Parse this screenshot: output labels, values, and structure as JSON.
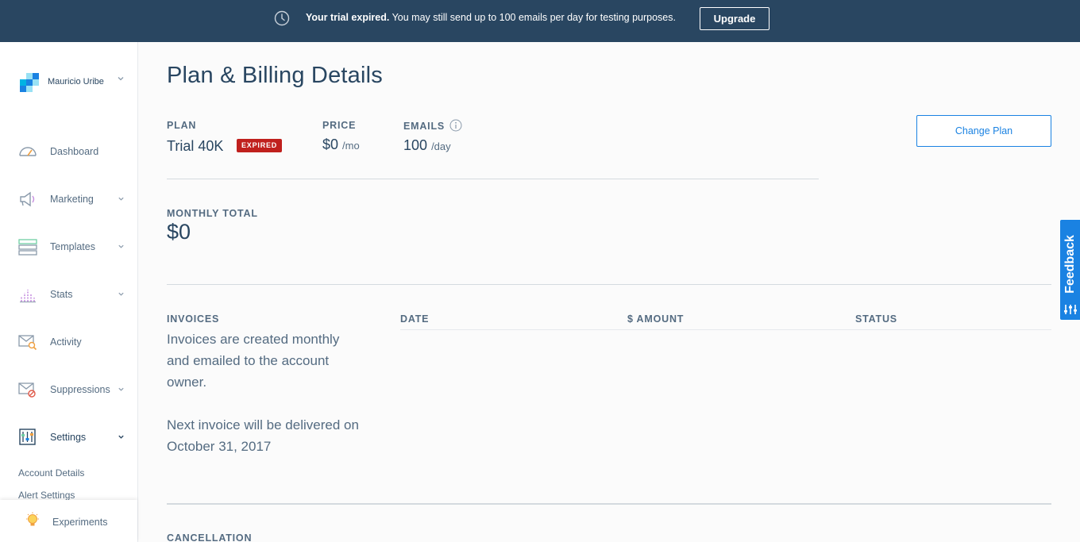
{
  "banner": {
    "icon": "clock-icon",
    "message_bold": "Your trial expired.",
    "message_rest": " You may still send up to 100 emails per day for testing purposes.",
    "upgrade_label": "Upgrade"
  },
  "sidebar": {
    "user_name": "Mauricio Uribe",
    "items": [
      {
        "label": "Dashboard",
        "icon": "speedometer-icon"
      },
      {
        "label": "Marketing",
        "icon": "megaphone-icon"
      },
      {
        "label": "Templates",
        "icon": "template-icon"
      },
      {
        "label": "Stats",
        "icon": "bar-chart-icon"
      },
      {
        "label": "Activity",
        "icon": "envelope-search-icon"
      },
      {
        "label": "Suppressions",
        "icon": "envelope-block-icon"
      },
      {
        "label": "Settings",
        "icon": "sliders-icon"
      }
    ],
    "settings_sub": [
      "Account Details",
      "Alert Settings"
    ],
    "experiments_label": "Experiments"
  },
  "main": {
    "title": "Plan & Billing Details",
    "plan": {
      "label": "PLAN",
      "value": "Trial 40K",
      "badge": "EXPIRED"
    },
    "price": {
      "label": "PRICE",
      "value": "$0",
      "unit": "/mo"
    },
    "emails": {
      "label": "EMAILS",
      "value": "100",
      "unit": "/day"
    },
    "change_plan_label": "Change Plan",
    "monthly_total": {
      "label": "MONTHLY TOTAL",
      "value": "$0"
    },
    "invoices": {
      "label": "INVOICES",
      "text1": "Invoices are created monthly and emailed to the account owner.",
      "text2": "Next invoice will be delivered on October 31, 2017",
      "columns": [
        "DATE",
        "$ AMOUNT",
        "STATUS"
      ]
    },
    "cancellation_label": "CANCELLATION"
  },
  "feedback_label": "Feedback",
  "colors": {
    "banner": "#294661",
    "accent": "#1a82e2",
    "expired": "#c0201d",
    "text": "#294661",
    "muted": "#546b81"
  }
}
